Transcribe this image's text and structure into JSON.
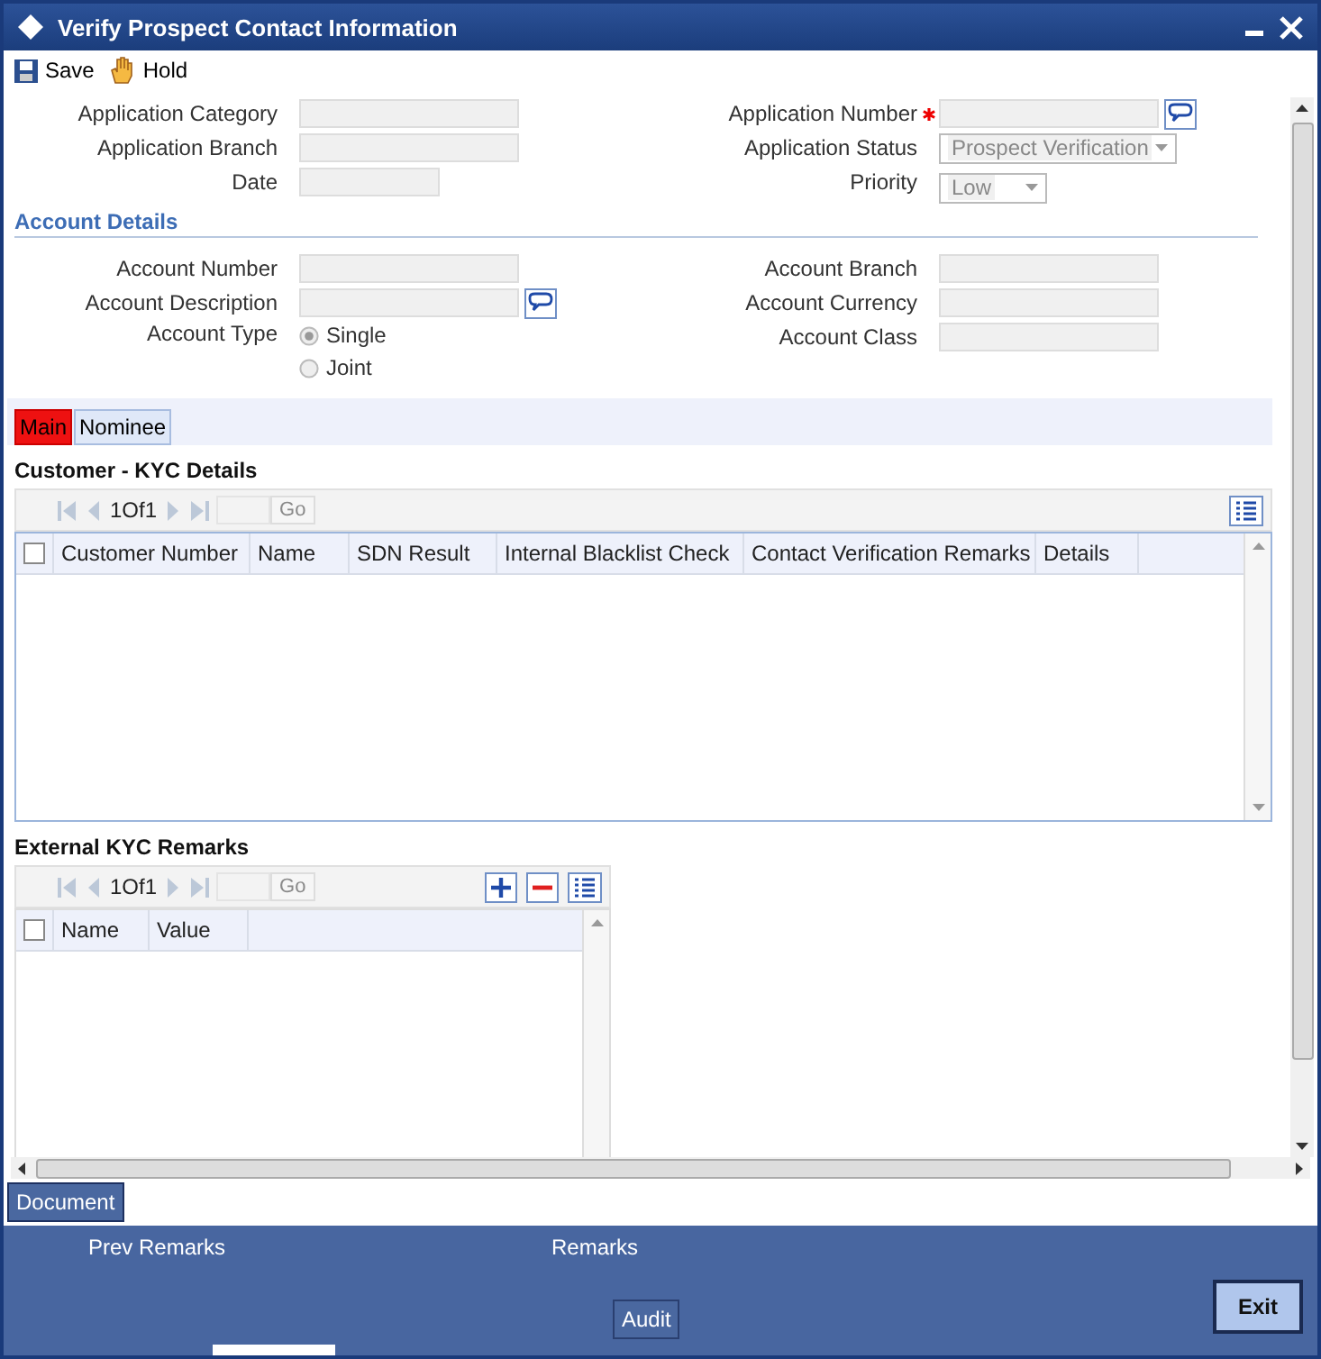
{
  "window": {
    "title": "Verify Prospect Contact Information"
  },
  "toolbar": [
    {
      "label": "Save",
      "kind": "save"
    },
    {
      "label": "Hold",
      "kind": "hold"
    }
  ],
  "header": {
    "left": [
      {
        "label": "Application Category",
        "kind": "text",
        "required": false
      },
      {
        "label": "Application Branch",
        "kind": "text",
        "required": false
      },
      {
        "label": "Date",
        "kind": "short",
        "required": false
      }
    ],
    "right": [
      {
        "label": "Application Number",
        "kind": "lookup",
        "required": true
      },
      {
        "label": "Application Status",
        "kind": "select",
        "value": "Prospect Verification",
        "required": false
      },
      {
        "label": "Priority",
        "kind": "select_short",
        "value": "Low",
        "required": false
      }
    ]
  },
  "account_details": {
    "title": "Account Details",
    "left": [
      {
        "label": "Account Number",
        "kind": "text"
      },
      {
        "label": "Account Description",
        "kind": "lookup"
      },
      {
        "label": "Account Type",
        "kind": "radio",
        "options": [
          {
            "label": "Single",
            "selected": true
          },
          {
            "label": "Joint",
            "selected": false
          }
        ]
      }
    ],
    "right": [
      {
        "label": "Account Branch",
        "kind": "text"
      },
      {
        "label": "Account Currency",
        "kind": "text"
      },
      {
        "label": "Account Class",
        "kind": "text"
      }
    ]
  },
  "tabs": [
    {
      "label": "Main",
      "selected": true
    },
    {
      "label": "Nominee",
      "selected": false
    }
  ],
  "kyc_grid": {
    "title": "Customer - KYC Details",
    "pager": "1Of1",
    "go": "Go",
    "select_all": false,
    "columns": [
      "Customer Number",
      "Name",
      "SDN Result",
      "Internal Blacklist Check",
      "Contact Verification Remarks",
      "Details"
    ]
  },
  "remarks_grid": {
    "title": "External KYC Remarks",
    "pager": "1Of1",
    "go": "Go",
    "select_all": false,
    "columns": [
      "Name",
      "Value"
    ]
  },
  "document_button": "Document",
  "footer": {
    "prev_remarks": "Prev Remarks",
    "remarks": "Remarks",
    "audit": "Audit",
    "exit": "Exit"
  }
}
